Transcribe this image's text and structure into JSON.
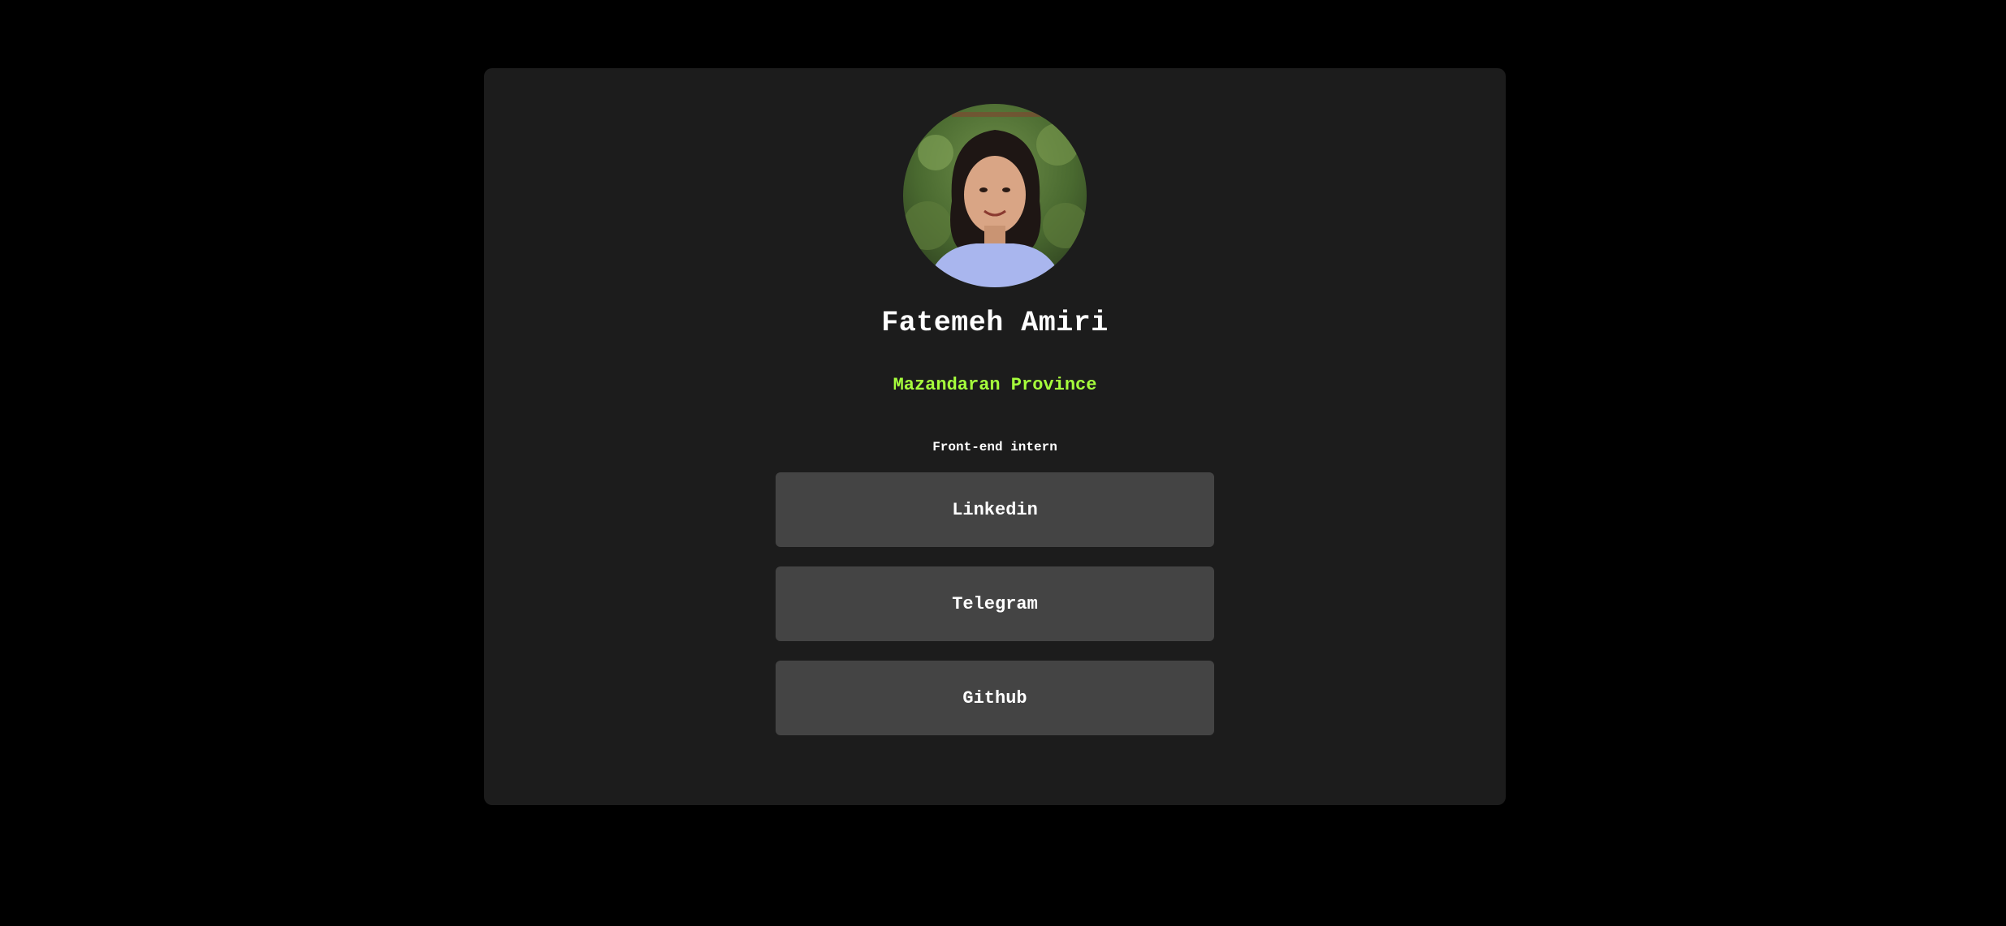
{
  "profile": {
    "name": "Fatemeh Amiri",
    "location": "Mazandaran Province",
    "role": "Front-end intern",
    "avatar_icon": "profile-photo"
  },
  "links": [
    {
      "label": "Linkedin"
    },
    {
      "label": "Telegram"
    },
    {
      "label": "Github"
    }
  ],
  "colors": {
    "page_background": "#000000",
    "card_background": "#1c1c1c",
    "button_background": "#444444",
    "location_accent": "#a6ff3c",
    "text": "#ffffff"
  }
}
